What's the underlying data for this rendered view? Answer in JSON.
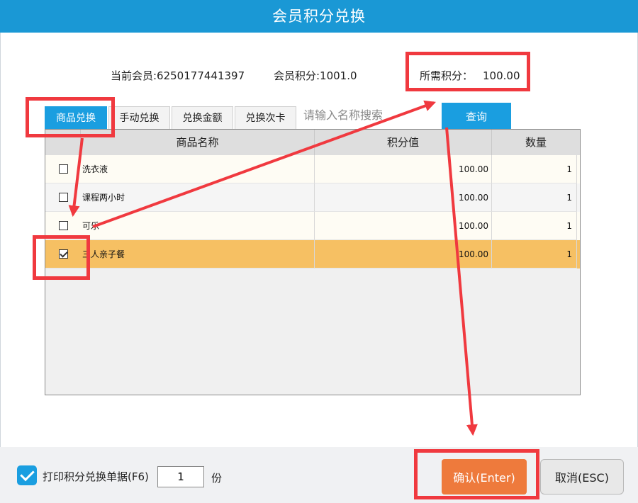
{
  "window": {
    "title": "会员积分兑换"
  },
  "info": {
    "member": "当前会员:6250177441397",
    "points": "会员积分:1001.0",
    "required_label": "所需积分：",
    "required_value": "100.00"
  },
  "tabs": [
    {
      "label": "商品兑换",
      "active": true
    },
    {
      "label": "手动兑换",
      "active": false
    },
    {
      "label": "兑换金额",
      "active": false
    },
    {
      "label": "兑换次卡",
      "active": false
    }
  ],
  "search": {
    "placeholder": "请输入名称搜索",
    "button_label": "查询"
  },
  "table": {
    "columns": [
      "商品名称",
      "积分值",
      "数量"
    ],
    "rows": [
      {
        "checked": false,
        "name": "洗衣液",
        "points": "100.00",
        "qty": "1"
      },
      {
        "checked": false,
        "name": "课程两小时",
        "points": "100.00",
        "qty": "1"
      },
      {
        "checked": false,
        "name": "可乐",
        "points": "100.00",
        "qty": "1"
      },
      {
        "checked": true,
        "name": "三人亲子餐",
        "points": "100.00",
        "qty": "1"
      }
    ]
  },
  "footer": {
    "print_checked": true,
    "print_label": "打印积分兑换单据(F6)",
    "copies": "1",
    "copies_unit": "份",
    "confirm_label": "确认(Enter)",
    "cancel_label": "取消(ESC)"
  },
  "colors": {
    "titlebar": "#1a98d5",
    "accent_blue": "#1a9ee0",
    "selected_row": "#f6c063",
    "row_odd": "#fefcf4",
    "row_even": "#f5f5f5",
    "confirm_button": "#ee7a3c",
    "annotation_red": "#f0393f"
  }
}
